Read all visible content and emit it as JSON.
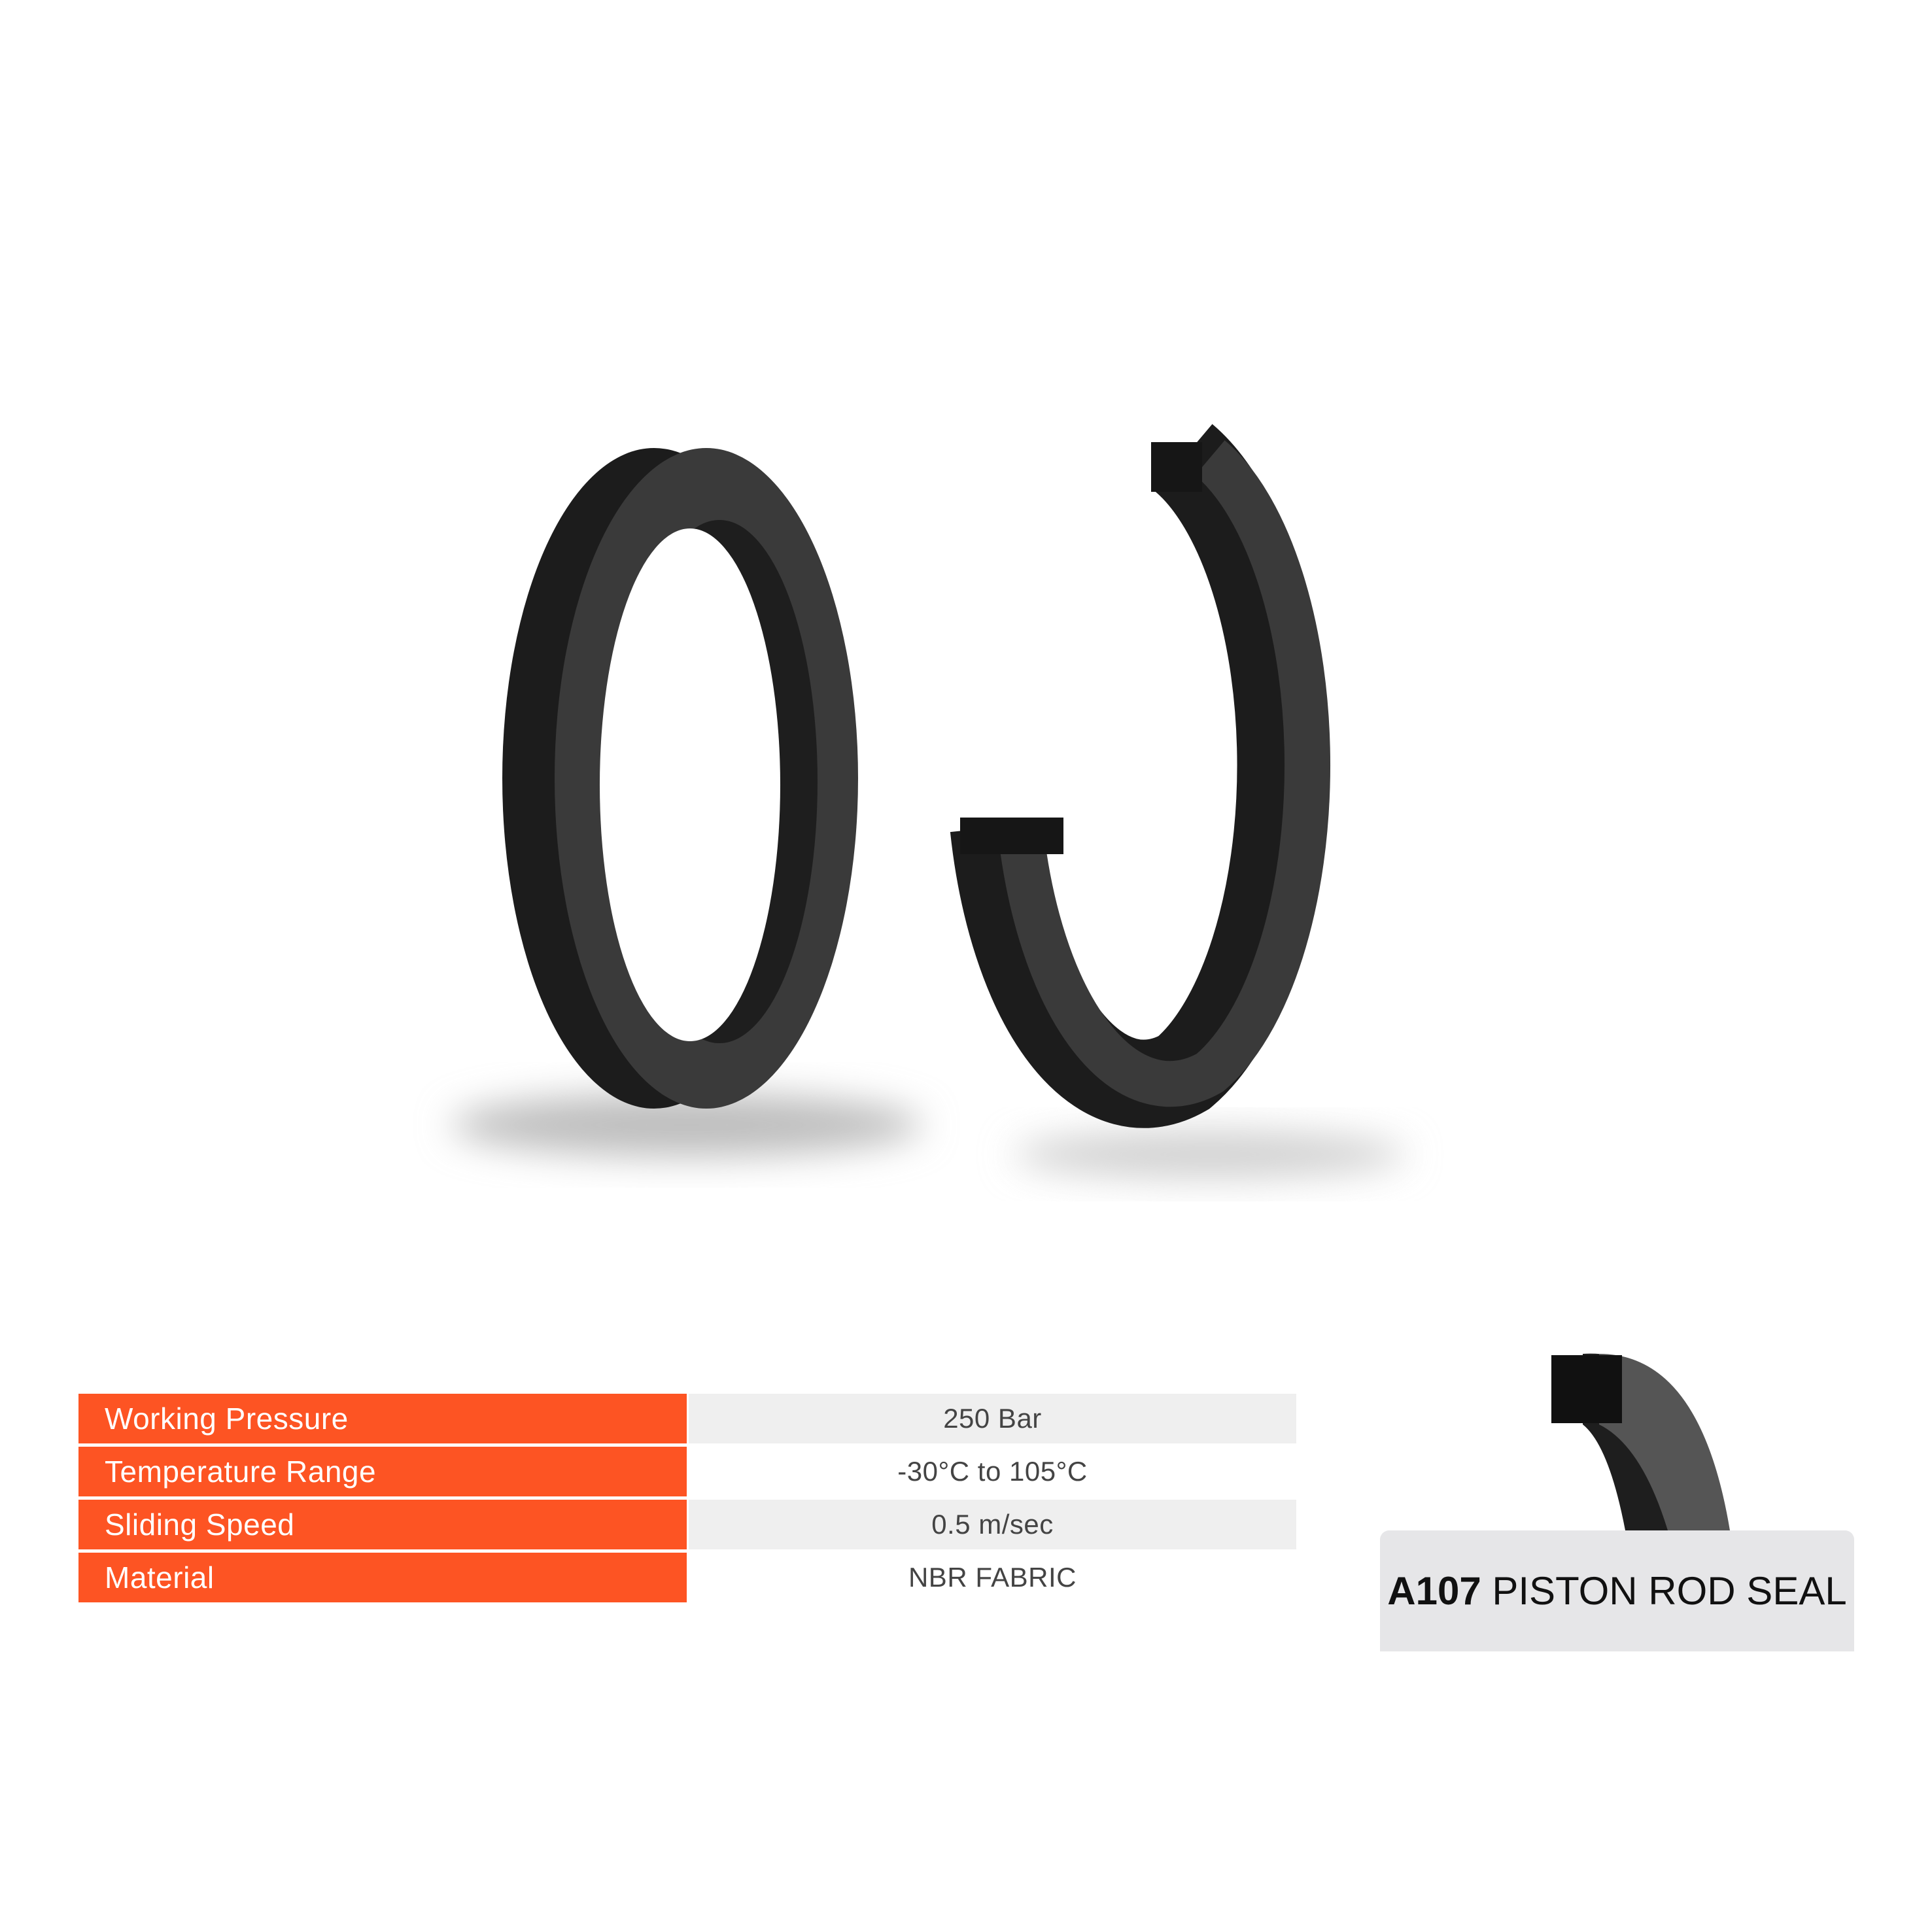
{
  "specs": [
    {
      "label": "Working Pressure",
      "value": "250 Bar"
    },
    {
      "label": "Temperature Range",
      "value": "-30°C to 105°C"
    },
    {
      "label": "Sliding Speed",
      "value": "0.5 m/sec"
    },
    {
      "label": "Material",
      "value": "NBR FABRIC"
    }
  ],
  "product": {
    "code": "A107",
    "name": "PISTON ROD SEAL"
  },
  "colors": {
    "accent": "#fd5423",
    "seal": "#2b2b2b",
    "label_bg": "#e6e6e8"
  }
}
